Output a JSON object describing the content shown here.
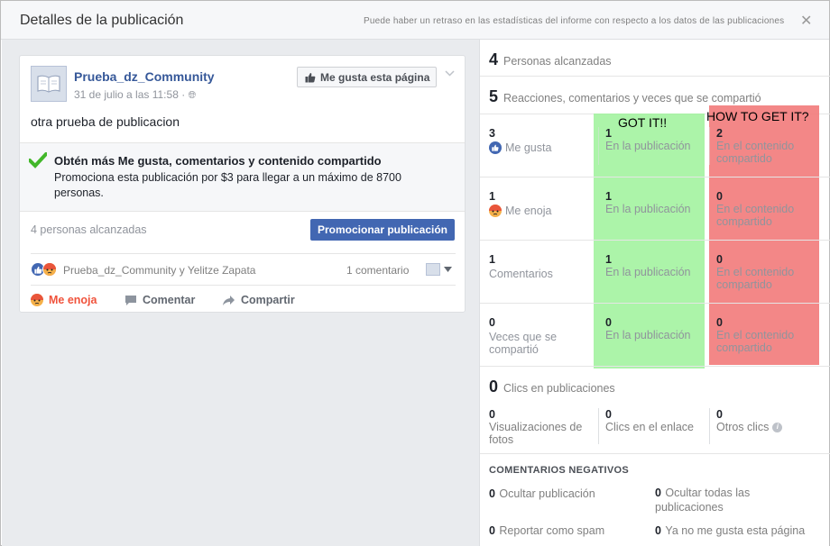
{
  "header": {
    "title": "Detalles de la publicación",
    "note": "Puede haber un retraso en las estadísticas del informe con respecto a los datos de las publicaciones",
    "close_icon": "✕"
  },
  "post": {
    "page_name": "Prueba_dz_Community",
    "date": "31 de julio a las 11:58 · ",
    "like_page_label": "Me gusta esta página",
    "text": "otra prueba de publicacion",
    "promo_title": "Obtén más Me gusta, comentarios y contenido compartido",
    "promo_desc": "Promociona esta publicación por $3 para llegar a un máximo de 8700 personas.",
    "reach": "4 personas alcanzadas",
    "promote_label": "Promocionar publicación",
    "reactors": "Prueba_dz_Community y Yelitze Zapata",
    "comments": "1 comentario",
    "actions": {
      "reaction": "Me enoja",
      "comment": "Comentar",
      "share": "Compartir"
    }
  },
  "stats": {
    "reach_num": "4",
    "reach_label": "Personas alcanzadas",
    "engage_num": "5",
    "engage_label": "Reacciones, comentarios y veces que se compartió",
    "annotations": {
      "got": "GOT IT!!",
      "how": "HOW TO GET IT?"
    },
    "rows": [
      {
        "total": "3",
        "label": "Me gusta",
        "on_post": "1",
        "on_post_label": "En la publicación",
        "shared": "2",
        "shared_label": "En el contenido compartido"
      },
      {
        "total": "1",
        "label": "Me enoja",
        "on_post": "1",
        "on_post_label": "En la publicación",
        "shared": "0",
        "shared_label": "En el contenido compartido"
      },
      {
        "total": "1",
        "label": "Comentarios",
        "on_post": "1",
        "on_post_label": "En la publicación",
        "shared": "0",
        "shared_label": "En el contenido compartido"
      },
      {
        "total": "0",
        "label": "Veces que se compartió",
        "on_post": "0",
        "on_post_label": "En la publicación",
        "shared": "0",
        "shared_label": "En el contenido compartido"
      }
    ],
    "clicks_num": "0",
    "clicks_label": "Clics en publicaciones",
    "click_cols": [
      {
        "num": "0",
        "label": "Visualizaciones de fotos"
      },
      {
        "num": "0",
        "label": "Clics en el enlace"
      },
      {
        "num": "0",
        "label": "Otros clics"
      }
    ],
    "negative_title": "COMENTARIOS NEGATIVOS",
    "negative": [
      {
        "num": "0",
        "label": "Ocultar publicación"
      },
      {
        "num": "0",
        "label": "Ocultar todas las publicaciones"
      },
      {
        "num": "0",
        "label": "Reportar como spam"
      },
      {
        "num": "0",
        "label": "Ya no me gusta esta página"
      }
    ]
  },
  "colors": {
    "accent": "#4267b2",
    "link": "#365899",
    "green_annotation": "#9ef29a",
    "red_annotation": "#f27a7a",
    "angry": "#f0533c"
  }
}
